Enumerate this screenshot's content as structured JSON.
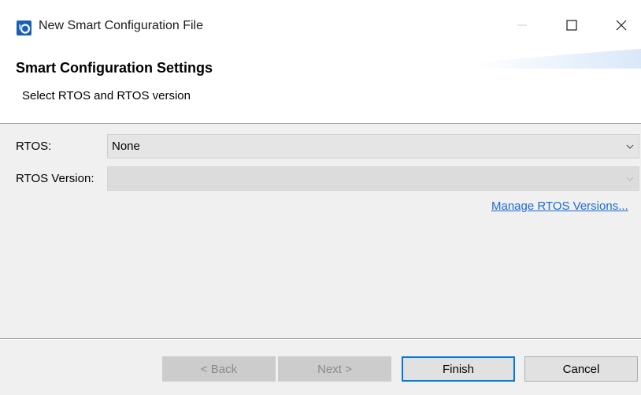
{
  "window": {
    "title": "New Smart Configuration File",
    "app_icon": "smart-configurator-icon",
    "controls": {
      "minimize_icon": "minimize-icon",
      "maximize_icon": "maximize-icon",
      "close_icon": "close-icon"
    }
  },
  "banner": {
    "title": "Smart Configuration Settings",
    "subtitle": "Select RTOS and RTOS version"
  },
  "form": {
    "rtos": {
      "label": "RTOS:",
      "value": "None"
    },
    "rtos_version": {
      "label": "RTOS Version:",
      "value": "",
      "enabled": false
    },
    "manage_link": "Manage RTOS Versions..."
  },
  "buttons": {
    "back": "< Back",
    "next": "Next >",
    "finish": "Finish",
    "cancel": "Cancel"
  },
  "colors": {
    "link": "#1c6ad6",
    "app_icon_blue": "#1a5fb4",
    "default_button_border": "#0078d7"
  }
}
